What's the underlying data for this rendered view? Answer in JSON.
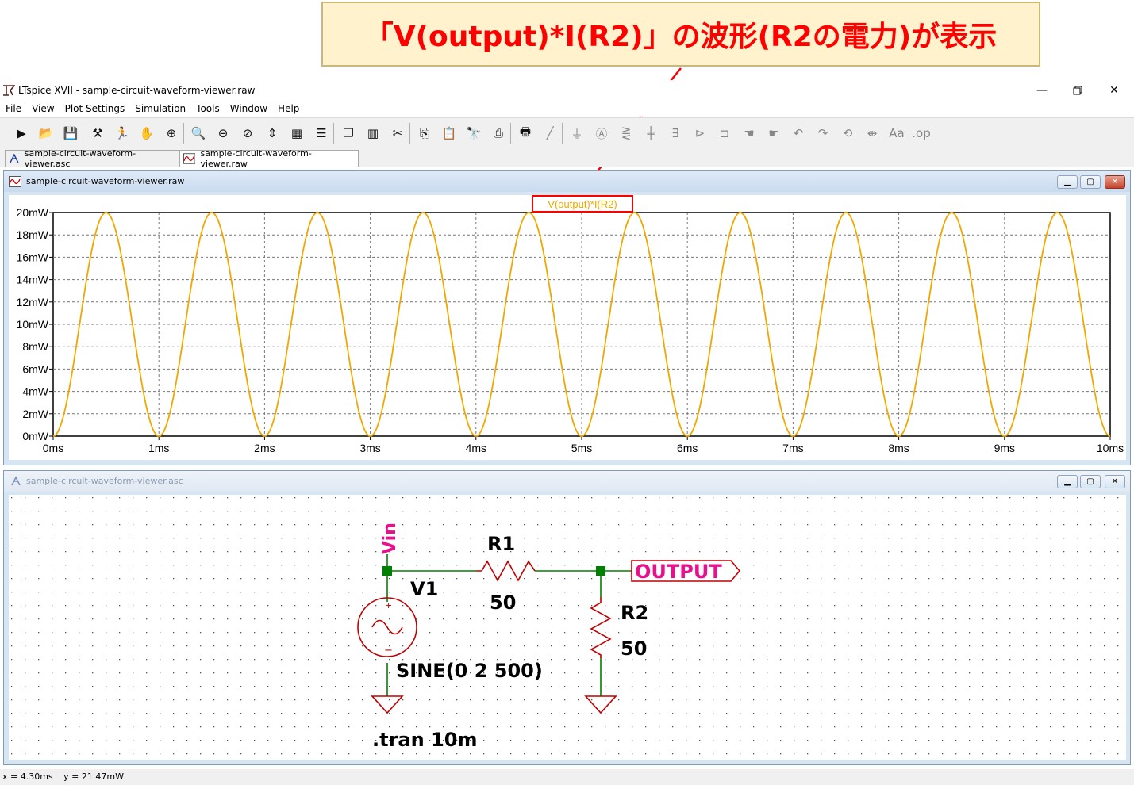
{
  "annotation": {
    "text": "「V(output)*I(R2)」の波形(R2の電力)が表示",
    "color": "#ff0000"
  },
  "window": {
    "title": "LTspice XVII - sample-circuit-waveform-viewer.raw"
  },
  "menu": [
    "File",
    "View",
    "Plot Settings",
    "Simulation",
    "Tools",
    "Window",
    "Help"
  ],
  "toolbar_icons": [
    "run-icon",
    "open-icon",
    "save-icon",
    "hammer-icon",
    "runner-icon",
    "hand-icon",
    "zoom-in-icon",
    "zoom-icon",
    "zoom-out-icon",
    "zoom-cancel-icon",
    "autorange-icon",
    "grid-icon",
    "tile-horizontal-icon",
    "cascade-icon",
    "tile-vertical-icon",
    "cut-icon",
    "copy-icon",
    "paste-icon",
    "find-icon",
    "print-icon",
    "print-setup-icon",
    "wire-icon",
    "ground-icon",
    "label-icon",
    "resistor-icon",
    "capacitor-icon",
    "inductor-icon",
    "diode-icon",
    "component-icon",
    "move-icon",
    "drag-icon",
    "undo-icon",
    "redo-icon",
    "rotate-icon",
    "mirror-icon",
    "text-icon",
    "spice-directive-icon"
  ],
  "tabs": [
    {
      "label": "sample-circuit-waveform-viewer.asc",
      "icon": "schematic-icon"
    },
    {
      "label": "sample-circuit-waveform-viewer.raw",
      "icon": "waveform-icon"
    }
  ],
  "plot_window": {
    "title": "sample-circuit-waveform-viewer.raw"
  },
  "schematic_window": {
    "title": "sample-circuit-waveform-viewer.asc"
  },
  "chart_data": {
    "type": "line",
    "title": "V(output)*I(R2)",
    "series": [
      {
        "name": "V(output)*I(R2)",
        "color": "#f0a800",
        "function": "20*sin(2*pi*500*t)^2",
        "frequency_hz": 500,
        "peak_mW": 20
      }
    ],
    "xlim": [
      0,
      10
    ],
    "ylim": [
      0,
      20
    ],
    "x_ticks": [
      "0ms",
      "1ms",
      "2ms",
      "3ms",
      "4ms",
      "5ms",
      "6ms",
      "7ms",
      "8ms",
      "9ms",
      "10ms"
    ],
    "y_ticks": [
      "0mW",
      "2mW",
      "4mW",
      "6mW",
      "8mW",
      "10mW",
      "12mW",
      "14mW",
      "16mW",
      "18mW",
      "20mW"
    ],
    "grid": true
  },
  "schematic": {
    "source_label": "V1",
    "source_value": "SINE(0 2 500)",
    "vin_label": "Vin",
    "r1_label": "R1",
    "r1_value": "50",
    "r2_label": "R2",
    "r2_value": "50",
    "output_label": "OUTPUT",
    "directive": ".tran 10m",
    "wire_color": "#008000",
    "component_color": "#c00000",
    "label_color": "#e8108c"
  },
  "status": {
    "x": "x = 4.30ms",
    "y": "y = 21.47mW"
  }
}
